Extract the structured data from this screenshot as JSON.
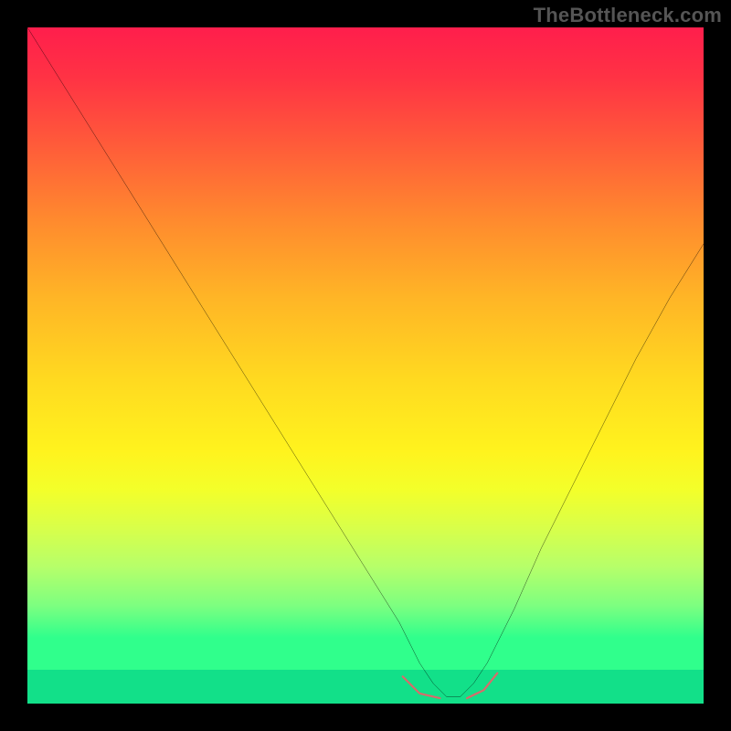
{
  "watermark": "TheBottleneck.com",
  "colors": {
    "frame": "#000000",
    "gradient_top": "#ff1e4c",
    "gradient_mid": "#ffe81e",
    "gradient_bottom": "#12e089",
    "curve": "#000000",
    "marker": "#d86b6b"
  },
  "chart_data": {
    "type": "line",
    "title": "",
    "xlabel": "",
    "ylabel": "",
    "xlim": [
      0,
      100
    ],
    "ylim": [
      0,
      100
    ],
    "axes_visible": false,
    "grid": false,
    "legend": false,
    "annotations": [
      {
        "text": "TheBottleneck.com",
        "position": "top-right"
      }
    ],
    "background": "vertical-gradient red→yellow→green with solid green band at bottom",
    "series": [
      {
        "name": "bottleneck-curve",
        "color": "#000000",
        "x": [
          0,
          5,
          10,
          15,
          20,
          25,
          30,
          35,
          40,
          45,
          50,
          55,
          58,
          60,
          62,
          64,
          66,
          68,
          72,
          76,
          80,
          85,
          90,
          95,
          100
        ],
        "y": [
          100,
          92,
          84,
          76,
          68,
          60,
          52,
          44,
          36,
          28,
          20,
          12,
          6,
          3,
          1,
          1,
          3,
          6,
          14,
          23,
          31,
          41,
          51,
          60,
          68
        ]
      }
    ],
    "markers": [
      {
        "name": "optimal-range-left",
        "shape": "short-thick-segment",
        "color": "#d86b6b",
        "x": [
          56,
          61
        ],
        "y": [
          3,
          1
        ]
      },
      {
        "name": "optimal-range-right",
        "shape": "short-thick-segment",
        "color": "#d86b6b",
        "x": [
          65,
          69
        ],
        "y": [
          1,
          4
        ]
      }
    ],
    "optimum_x": 63
  }
}
